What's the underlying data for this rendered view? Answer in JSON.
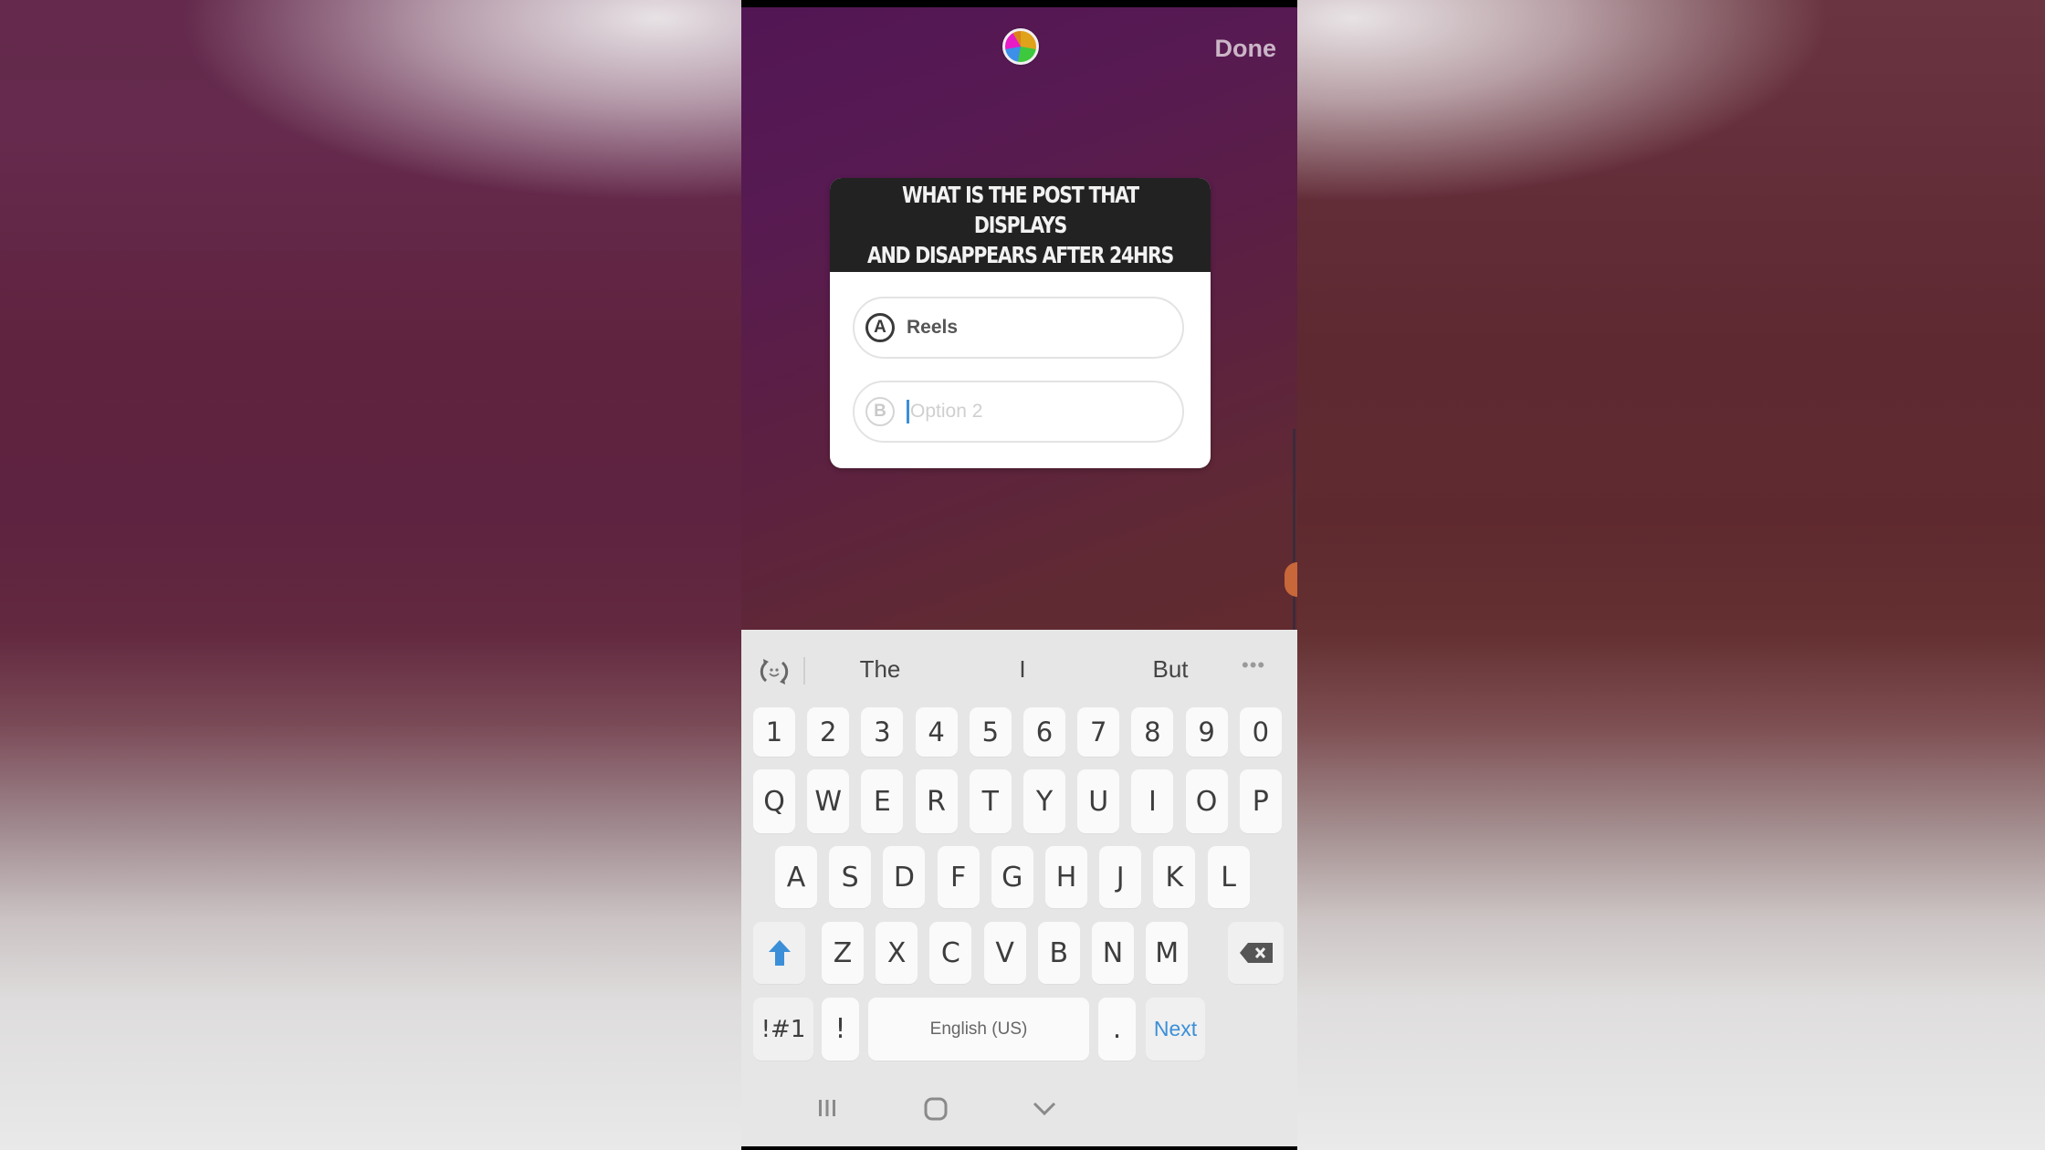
{
  "story_editor": {
    "done_label": "Done",
    "color_picker_icon": "color-wheel-icon",
    "quiz_sticker": {
      "question": "WHAT IS THE POST THAT DISPLAYS\nAND DISAPPEARS AFTER 24HRS",
      "options": [
        {
          "letter": "A",
          "value": "Reels",
          "placeholder": ""
        },
        {
          "letter": "B",
          "value": "",
          "placeholder": "Option 2"
        }
      ]
    }
  },
  "keyboard": {
    "suggestions": [
      "The",
      "I",
      "But"
    ],
    "more_label": "•••",
    "number_row": [
      "1",
      "2",
      "3",
      "4",
      "5",
      "6",
      "7",
      "8",
      "9",
      "0"
    ],
    "row1": [
      "Q",
      "W",
      "E",
      "R",
      "T",
      "Y",
      "U",
      "I",
      "O",
      "P"
    ],
    "row2": [
      "A",
      "S",
      "D",
      "F",
      "G",
      "H",
      "J",
      "K",
      "L"
    ],
    "row3": [
      "Z",
      "X",
      "C",
      "V",
      "B",
      "N",
      "M"
    ],
    "symbols_label": "!#1",
    "exclaim_label": "!",
    "space_label": "English (US)",
    "period_label": ".",
    "action_label": "Next"
  },
  "colors": {
    "accent_blue": "#3b8fd8",
    "quiz_header_bg": "#222222",
    "slider_handle": "#c8673a"
  }
}
